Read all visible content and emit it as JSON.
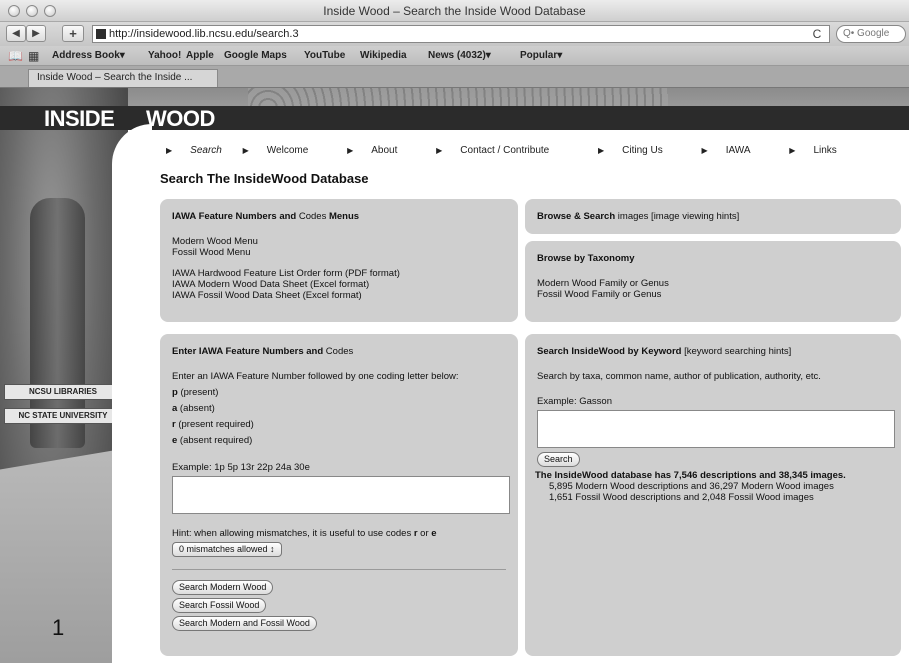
{
  "window": {
    "title": "Inside Wood – Search the Inside Wood Database"
  },
  "toolbar": {
    "back": "◀",
    "forward": "▶",
    "add": "+",
    "url": "http://insidewood.lib.ncsu.edu/search.3",
    "reload": "C",
    "search_placeholder": "Q• Google"
  },
  "bookmarks": [
    "Address Book▾",
    "Yahoo!",
    "Apple",
    "Google Maps",
    "YouTube",
    "Wikipedia",
    "News (4032)▾",
    "Popular▾"
  ],
  "tab": {
    "label": "Inside Wood – Search the Inside ..."
  },
  "brand": {
    "left": "INSIDE",
    "right": "WOOD"
  },
  "libraries": {
    "ncsu": "NCSU LIBRARIES",
    "nc_state": "NC STATE UNIVERSITY"
  },
  "nav": [
    "Search",
    "Welcome",
    "About",
    "Contact / Contribute",
    "Citing Us",
    "IAWA",
    "Links"
  ],
  "page_title": "Search The InsideWood Database",
  "panels": {
    "menus": {
      "title_bold1": "IAWA Feature Numbers and",
      "title_normal": " Codes ",
      "title_bold2": "Menus",
      "links1": [
        "Modern Wood Menu",
        "Fossil Wood Menu"
      ],
      "links2": [
        "IAWA Hardwood Feature List Order form (PDF format)",
        "IAWA Modern Wood Data Sheet (Excel format)",
        "IAWA Fossil Wood Data Sheet (Excel format)"
      ]
    },
    "browse_images": {
      "bold": "Browse & Search",
      "normal": " images [image viewing hints]"
    },
    "taxonomy": {
      "title": "Browse by Taxonomy",
      "links": [
        "Modern Wood Family or Genus",
        "Fossil Wood Family or Genus"
      ]
    },
    "enter_codes": {
      "title_bold": "Enter IAWA Feature Numbers and",
      "title_normal": " Codes",
      "instructions": "Enter an IAWA Feature Number followed by one coding letter below:",
      "codes": [
        {
          "letter": "p",
          "desc": " (present)"
        },
        {
          "letter": "a",
          "desc": " (absent)"
        },
        {
          "letter": "r",
          "desc": " (present required)"
        },
        {
          "letter": "e",
          "desc": " (absent required)"
        }
      ],
      "example": "Example: 1p 5p 13r 22p 24a 30e",
      "hint_prefix": "Hint: when allowing mismatches, it is useful to use codes ",
      "hint_r": "r",
      "hint_or": " or ",
      "hint_e": "e",
      "mismatch_select": "0 mismatches allowed ↕",
      "buttons": [
        "Search Modern Wood",
        "Search Fossil Wood",
        "Search Modern and Fossil Wood"
      ]
    },
    "keyword": {
      "title_bold": "Search InsideWood by Keyword",
      "title_normal": " [keyword searching hints]",
      "description": "Search by taxa, common name, author of publication, authority, etc.",
      "example": "Example: Gasson",
      "button": "Search",
      "stats_main": "The InsideWood database has 7,546 descriptions and 38,345 images.",
      "stats_modern": "5,895 Modern Wood descriptions and 36,297 Modern Wood images",
      "stats_fossil": "1,651 Fossil Wood descriptions and 2,048 Fossil Wood images"
    }
  },
  "page_number": "1"
}
